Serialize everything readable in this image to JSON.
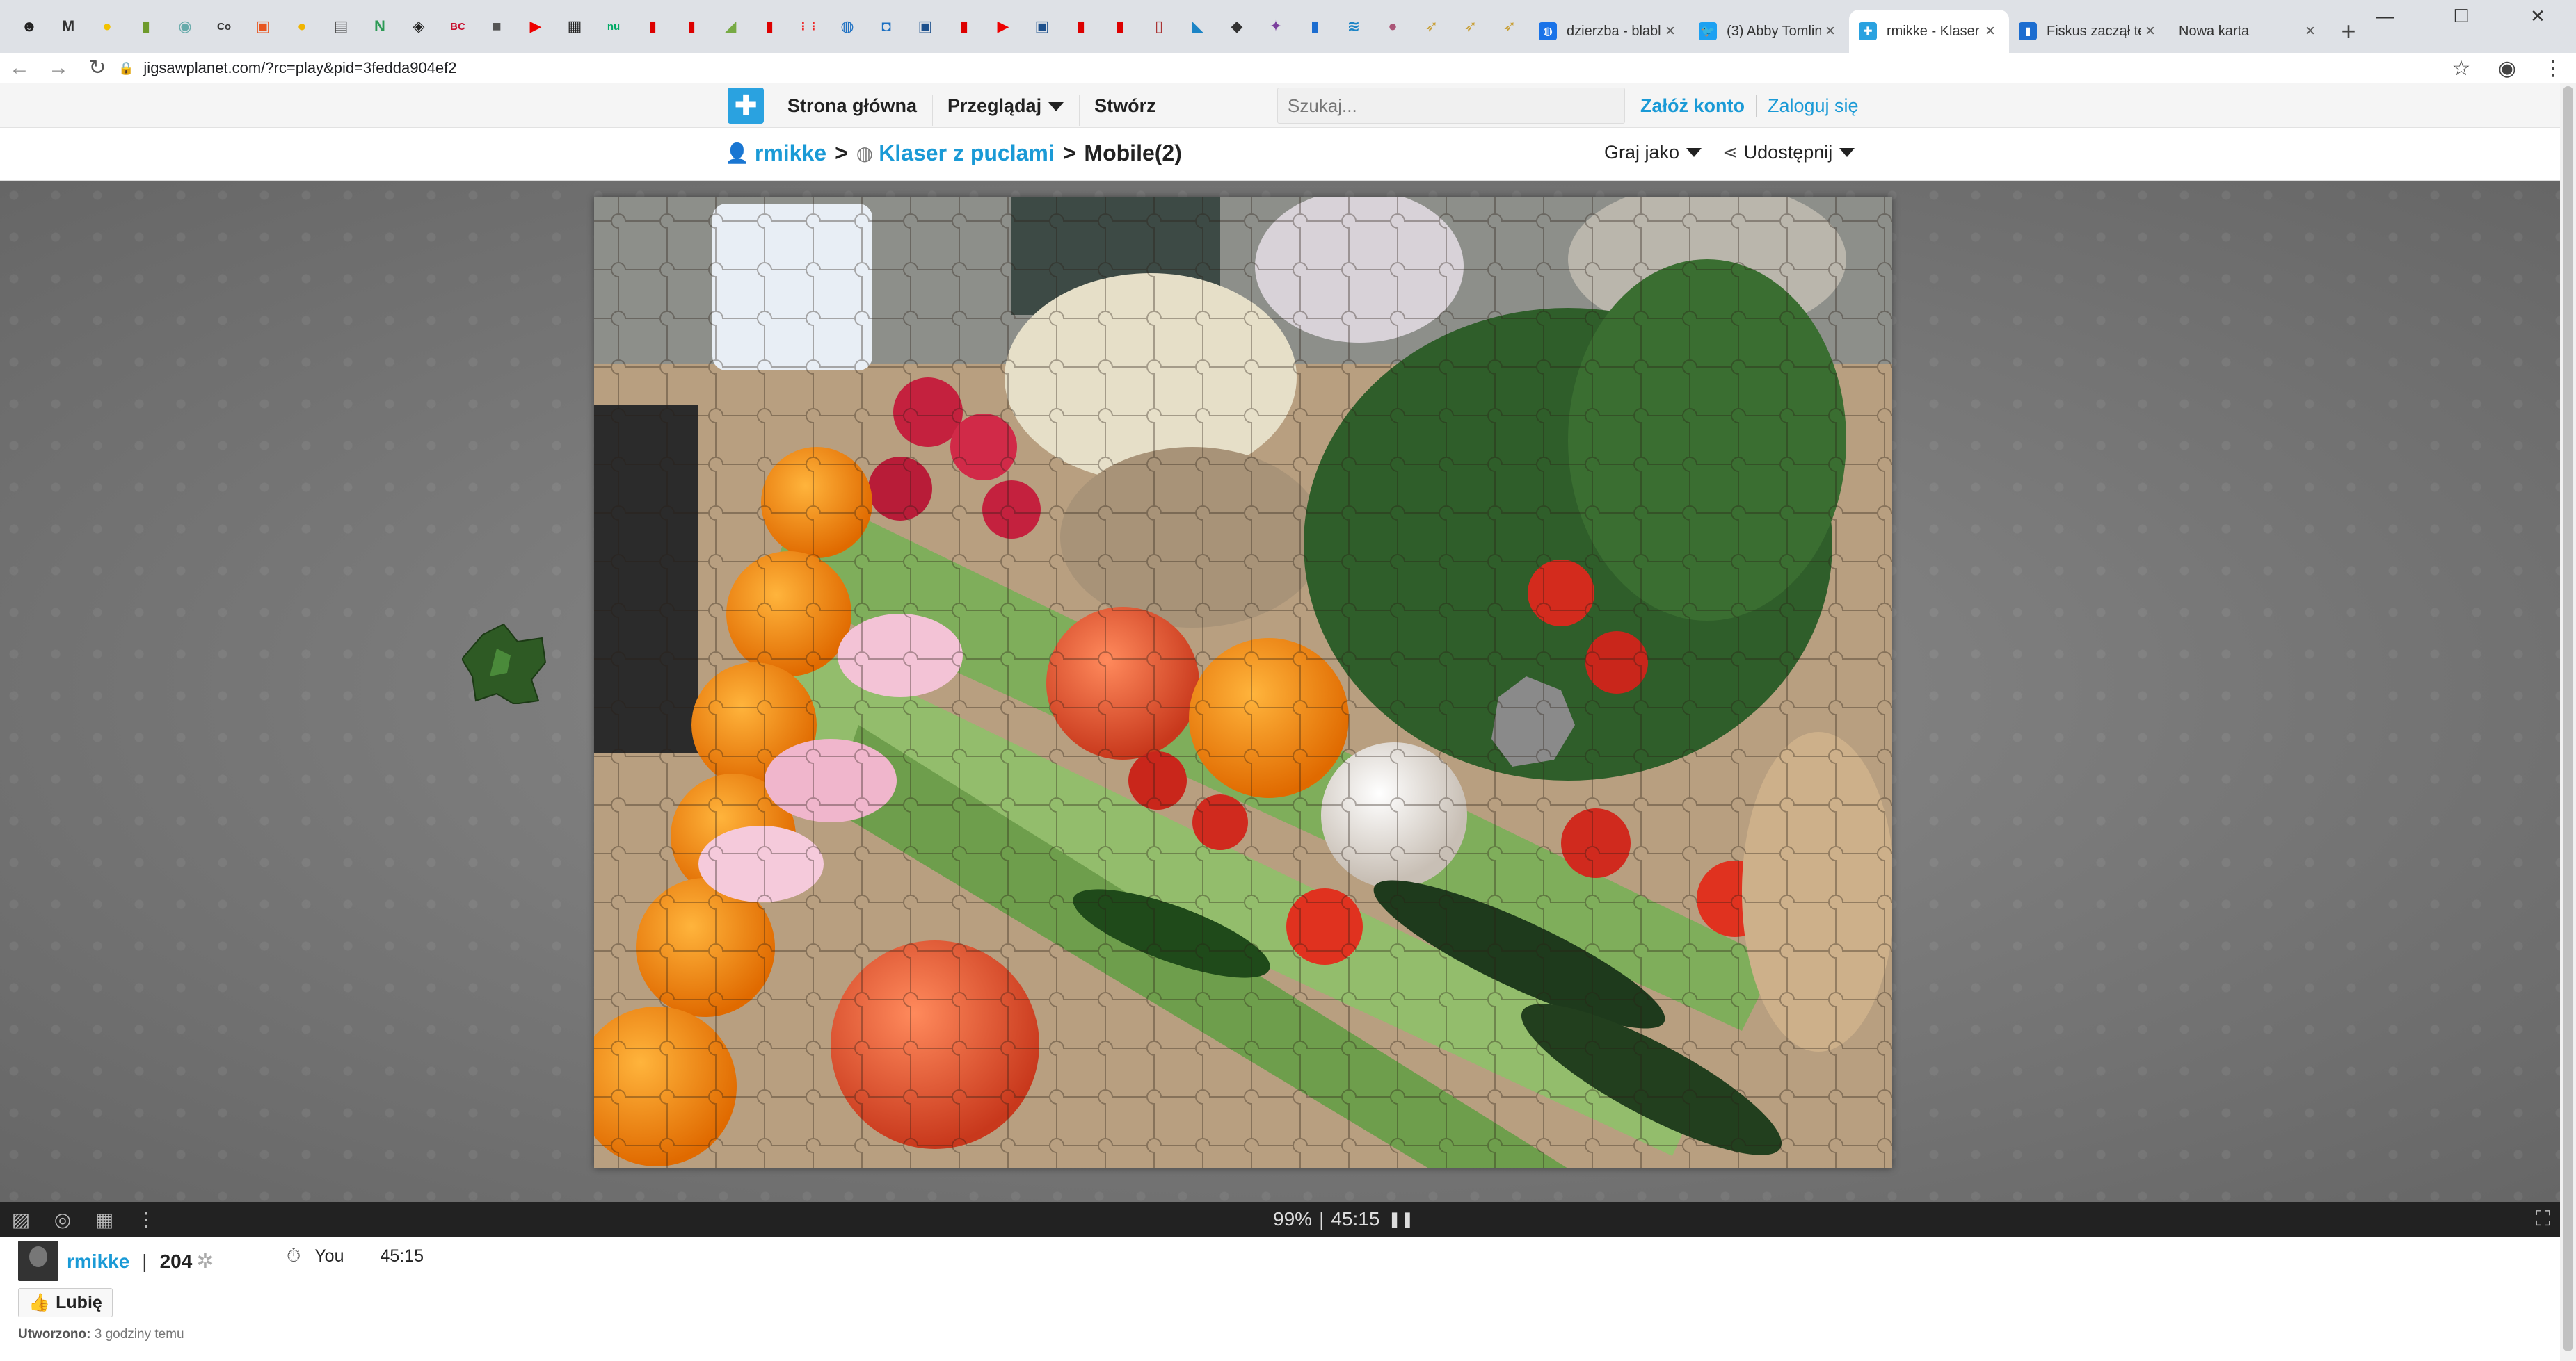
{
  "browser": {
    "pinned_tabs": [
      {
        "icon": "app-icon",
        "glyph": "☻",
        "color": "#222"
      },
      {
        "icon": "gmail-icon",
        "glyph": "M",
        "color": "#333"
      },
      {
        "icon": "sun-icon",
        "glyph": "●",
        "color": "#f2c200"
      },
      {
        "icon": "leaf-icon",
        "glyph": "▮",
        "color": "#6e9a2c"
      },
      {
        "icon": "app-icon",
        "glyph": "◉",
        "color": "#6aa"
      },
      {
        "icon": "text-icon",
        "glyph": "Co",
        "color": "#333"
      },
      {
        "icon": "app-icon",
        "glyph": "▣",
        "color": "#e8541e"
      },
      {
        "icon": "coin-icon",
        "glyph": "●",
        "color": "#f0b400"
      },
      {
        "icon": "news-icon",
        "glyph": "▤",
        "color": "#444"
      },
      {
        "icon": "app-icon",
        "glyph": "N",
        "color": "#2c9a55"
      },
      {
        "icon": "shield-icon",
        "glyph": "◈",
        "color": "#222"
      },
      {
        "icon": "app-icon",
        "glyph": "BC",
        "color": "#c8102e"
      },
      {
        "icon": "box-icon",
        "glyph": "■",
        "color": "#555"
      },
      {
        "icon": "youtube-icon",
        "glyph": "▶",
        "color": "#e00"
      },
      {
        "icon": "app-icon",
        "glyph": "▦",
        "color": "#222"
      },
      {
        "icon": "app-icon",
        "glyph": "nu",
        "color": "#0a6"
      },
      {
        "icon": "bookmark-icon",
        "glyph": "▮",
        "color": "#d00"
      },
      {
        "icon": "bookmark-icon",
        "glyph": "▮",
        "color": "#d00"
      },
      {
        "icon": "leaf-icon",
        "glyph": "◢",
        "color": "#7a4"
      },
      {
        "icon": "bookmark-icon",
        "glyph": "▮",
        "color": "#d00"
      },
      {
        "icon": "grid-icon",
        "glyph": "⋮⋮",
        "color": "#e22"
      },
      {
        "icon": "globe-icon",
        "glyph": "◍",
        "color": "#1b6fc2"
      },
      {
        "icon": "shield-icon",
        "glyph": "◘",
        "color": "#1b6fc2"
      },
      {
        "icon": "app-icon",
        "glyph": "▣",
        "color": "#1b4f8c"
      },
      {
        "icon": "bookmark-icon",
        "glyph": "▮",
        "color": "#d00"
      },
      {
        "icon": "youtube-icon",
        "glyph": "▶",
        "color": "#e00"
      },
      {
        "icon": "app-icon",
        "glyph": "▣",
        "color": "#1b4f8c"
      },
      {
        "icon": "bookmark-icon",
        "glyph": "▮",
        "color": "#d00"
      },
      {
        "icon": "bookmark-icon",
        "glyph": "▮",
        "color": "#d00"
      },
      {
        "icon": "doc-icon",
        "glyph": "▯",
        "color": "#a33"
      },
      {
        "icon": "app-icon",
        "glyph": "◣",
        "color": "#1c84c6"
      },
      {
        "icon": "cube-icon",
        "glyph": "◆",
        "color": "#333"
      },
      {
        "icon": "app-icon",
        "glyph": "✦",
        "color": "#7a3e9d"
      },
      {
        "icon": "bookmark-icon",
        "glyph": "▮",
        "color": "#1c6dd0"
      },
      {
        "icon": "app-icon",
        "glyph": "≋",
        "color": "#1c84c6"
      },
      {
        "icon": "avatar-icon",
        "glyph": "●",
        "color": "#a57"
      },
      {
        "icon": "wing-icon",
        "glyph": "➶",
        "color": "#c9a13b"
      },
      {
        "icon": "wing-icon",
        "glyph": "➶",
        "color": "#c9a13b"
      },
      {
        "icon": "wing-icon",
        "glyph": "➶",
        "color": "#c9a13b"
      }
    ],
    "tabs": [
      {
        "title": "dzierzba - blabl",
        "icon": "globe-icon",
        "color": "#1a73e8",
        "active": false
      },
      {
        "title": "(3) Abby Tomlin",
        "icon": "twitter-icon",
        "color": "#1da1f2",
        "active": false
      },
      {
        "title": "rmikke - Klaser z",
        "icon": "puzzle-icon",
        "color": "#2aa2e0",
        "active": true
      },
      {
        "title": "Fiskus zaczął te",
        "icon": "bookmark-icon",
        "color": "#1c6dd0",
        "active": false
      },
      {
        "title": "Nowa karta",
        "icon": "",
        "color": "",
        "active": false
      }
    ],
    "url": "jigsawplanet.com/?rc=play&pid=3fedda904ef2"
  },
  "site": {
    "nav": {
      "home": "Strona główna",
      "browse": "Przeglądaj",
      "create": "Stwórz"
    },
    "search_placeholder": "Szukaj...",
    "register": "Załóż konto",
    "login": "Zaloguj się"
  },
  "breadcrumb": {
    "user": "rmikke",
    "sep": ">",
    "album": "Klaser z puclami",
    "current": "Mobile(2)"
  },
  "play_options": {
    "play_as": "Graj jako",
    "share": "Udostępnij"
  },
  "puzzle": {
    "progress_percent": 99,
    "status_sep": "|",
    "elapsed": "45:15"
  },
  "footer": {
    "username": "rmikke",
    "separator": "|",
    "piece_count": "204",
    "timer_player": "You",
    "timer_value": "45:15",
    "like_label": "Lubię",
    "created_label": "Utworzono:",
    "created_value": "3 godziny temu"
  },
  "colors": {
    "link": "#1a9ad6",
    "board": "#7a7a7a",
    "control_bar": "#222222"
  }
}
